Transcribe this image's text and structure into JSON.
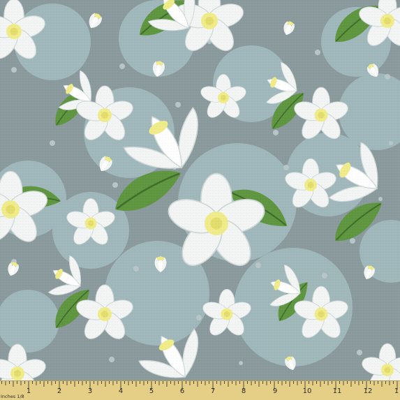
{
  "colors": {
    "background": "#8b9a9c",
    "bubble": "#a8c2c6",
    "dot": "#b9c6c8",
    "petal": "#f3f5f4",
    "petal_shadow": "#ced8d8",
    "leaf": "#5f9640",
    "leaf_dark": "#3f6d2a",
    "stamen": "#f0ec8a",
    "ruler": "#e5cf86",
    "ruler_ink": "#2b2a26"
  },
  "ruler": {
    "unit_label": "Inches 1/8",
    "numbers": [
      "1",
      "2",
      "3",
      "4",
      "5",
      "6",
      "7",
      "8",
      "9",
      "10",
      "11",
      "12",
      "1"
    ]
  }
}
